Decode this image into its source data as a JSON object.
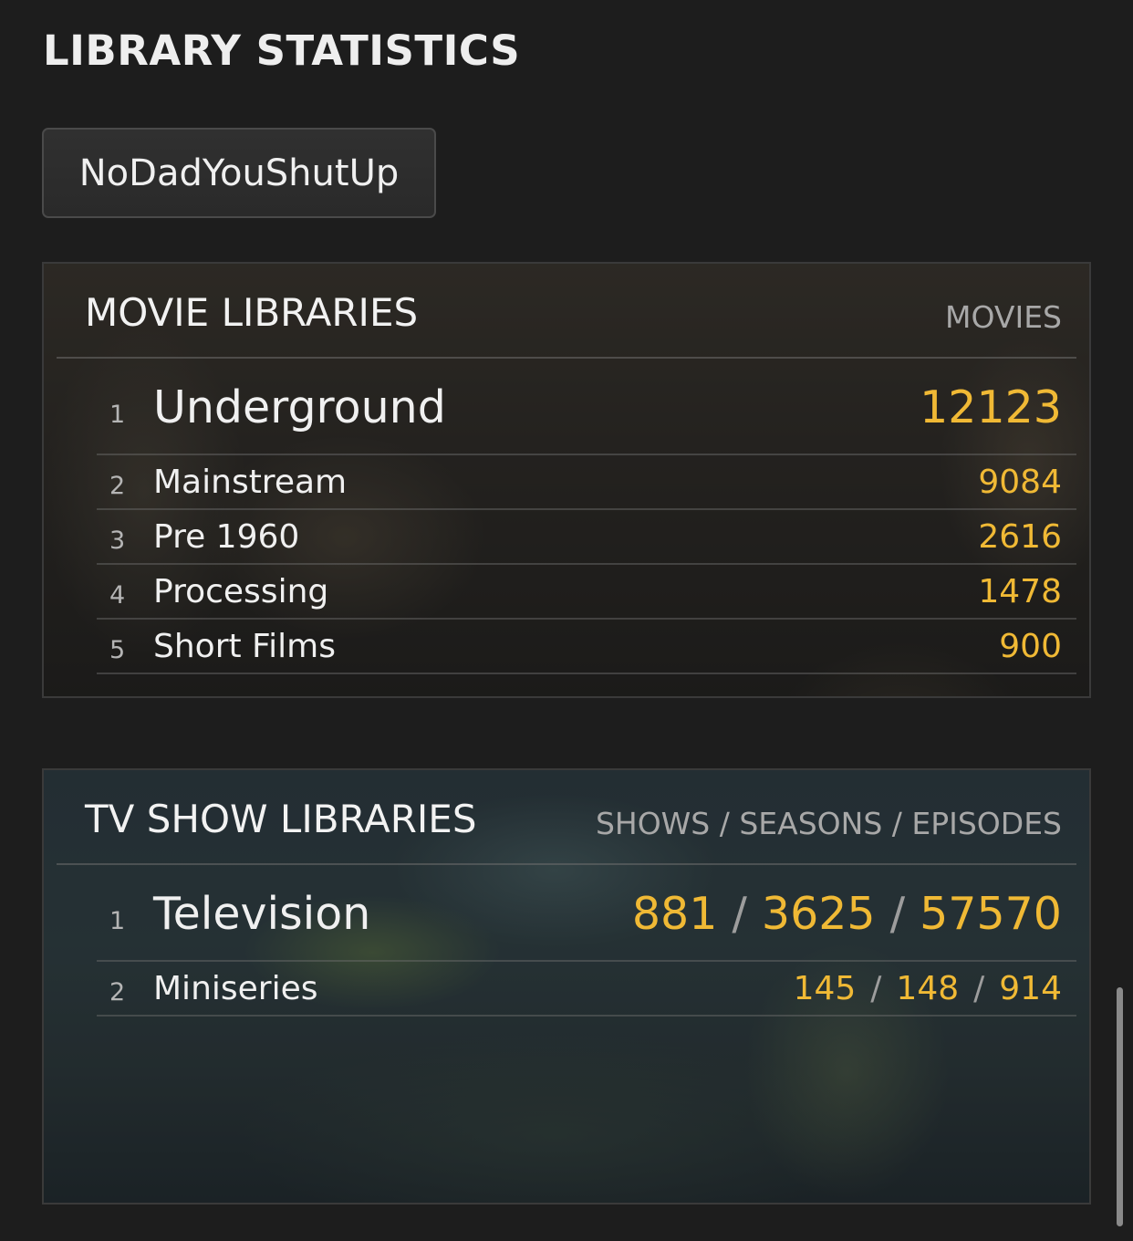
{
  "page_title": "LIBRARY STATISTICS",
  "user_button": {
    "label": "NoDadYouShutUp"
  },
  "movie_libraries": {
    "title": "MOVIE LIBRARIES",
    "column_label": "MOVIES",
    "rows": [
      {
        "rank": "1",
        "name": "Underground",
        "count": "12123"
      },
      {
        "rank": "2",
        "name": "Mainstream",
        "count": "9084"
      },
      {
        "rank": "3",
        "name": "Pre 1960",
        "count": "2616"
      },
      {
        "rank": "4",
        "name": "Processing",
        "count": "1478"
      },
      {
        "rank": "5",
        "name": "Short Films",
        "count": "900"
      }
    ]
  },
  "tv_libraries": {
    "title": "TV SHOW LIBRARIES",
    "column_label": "SHOWS / SEASONS / EPISODES",
    "separator": "/",
    "rows": [
      {
        "rank": "1",
        "name": "Television",
        "shows": "881",
        "seasons": "3625",
        "episodes": "57570"
      },
      {
        "rank": "2",
        "name": "Miniseries",
        "shows": "145",
        "seasons": "148",
        "episodes": "914"
      }
    ]
  },
  "colors": {
    "accent": "#f0b935",
    "background": "#1d1d1d"
  }
}
